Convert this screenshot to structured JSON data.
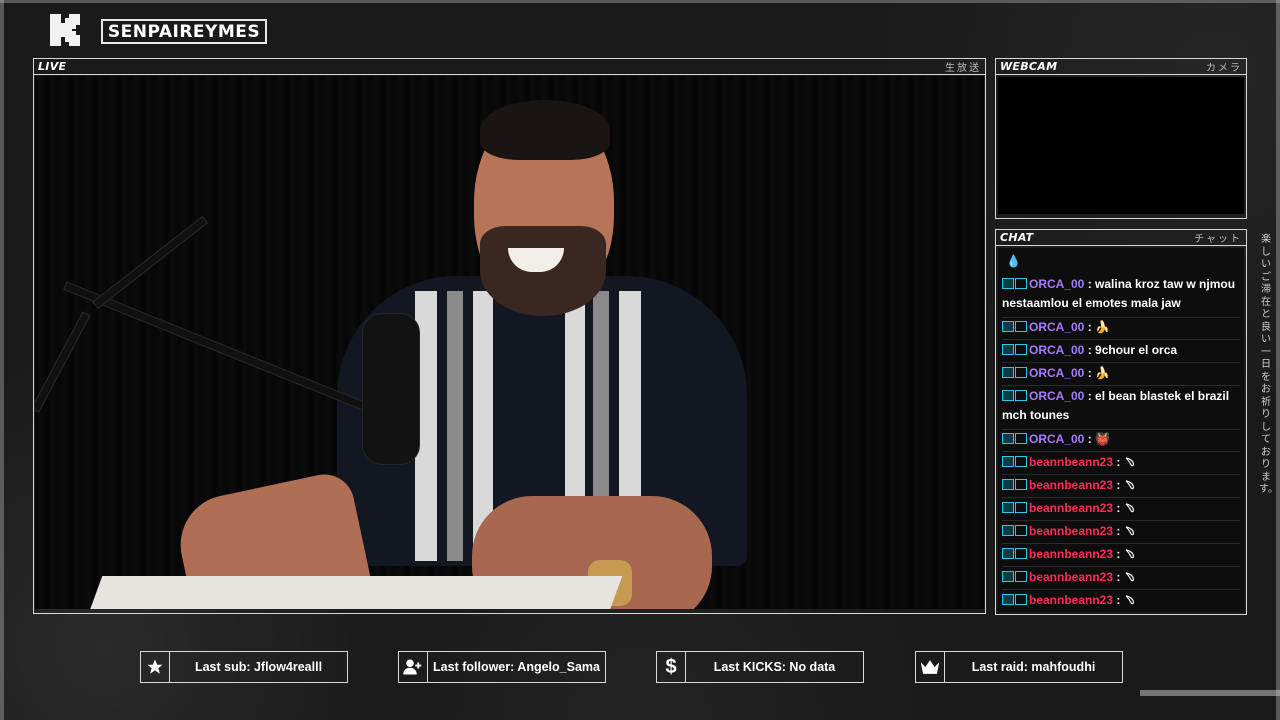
{
  "header": {
    "channel_name": "SENPAIREYMES",
    "logo_icon": "kick-logo-icon"
  },
  "live_panel": {
    "tag": "LIVE",
    "jp": "生放送"
  },
  "webcam_panel": {
    "tag": "WEBCAM",
    "jp": "カメラ"
  },
  "chat_panel": {
    "tag": "CHAT",
    "jp": "チャット",
    "messages": [
      {
        "user": "ORCA_00",
        "sep": " : ",
        "text": "walina kroz taw w njmou",
        "text2": "nestaamlou el emotes mala jaw"
      },
      {
        "user": "ORCA_00",
        "sep": " : ",
        "text": "🍌"
      },
      {
        "user": "ORCA_00",
        "sep": " : ",
        "text": "9chour el orca"
      },
      {
        "user": "ORCA_00",
        "sep": " : ",
        "text": "🍌"
      },
      {
        "user": "ORCA_00",
        "sep": " : ",
        "text": "el bean blastek el brazil",
        "text2": "mch tounes"
      },
      {
        "user": "ORCA_00",
        "sep": " : ",
        "text": "👹"
      },
      {
        "user": "beannbeann23",
        "sep": " : ",
        "text": "﹆"
      },
      {
        "user": "beannbeann23",
        "sep": " : ",
        "text": "﹆"
      },
      {
        "user": "beannbeann23",
        "sep": " : ",
        "text": "﹆"
      },
      {
        "user": "beannbeann23",
        "sep": " : ",
        "text": "﹆"
      },
      {
        "user": "beannbeann23",
        "sep": " : ",
        "text": "﹆"
      },
      {
        "user": "beannbeann23",
        "sep": " : ",
        "text": "﹆"
      },
      {
        "user": "beannbeann23",
        "sep": " : ",
        "text": "﹆"
      }
    ]
  },
  "side_text": "楽しいご滞在と良い一日をお祈りしております。",
  "stats": [
    {
      "icon": "star-icon",
      "label": "Last sub: Jflow4realll"
    },
    {
      "icon": "add-user-icon",
      "label": "Last follower: Angelo_Sama"
    },
    {
      "icon": "dollar-icon",
      "label": "Last KICKS: No data"
    },
    {
      "icon": "crown-icon",
      "label": "Last raid: mahfoudhi"
    }
  ],
  "colors": {
    "accent": "#28c8e8",
    "orca": "#a77bff",
    "bean": "#ff2d55",
    "border": "#d8d8d8",
    "background": "#1a1a1a"
  }
}
